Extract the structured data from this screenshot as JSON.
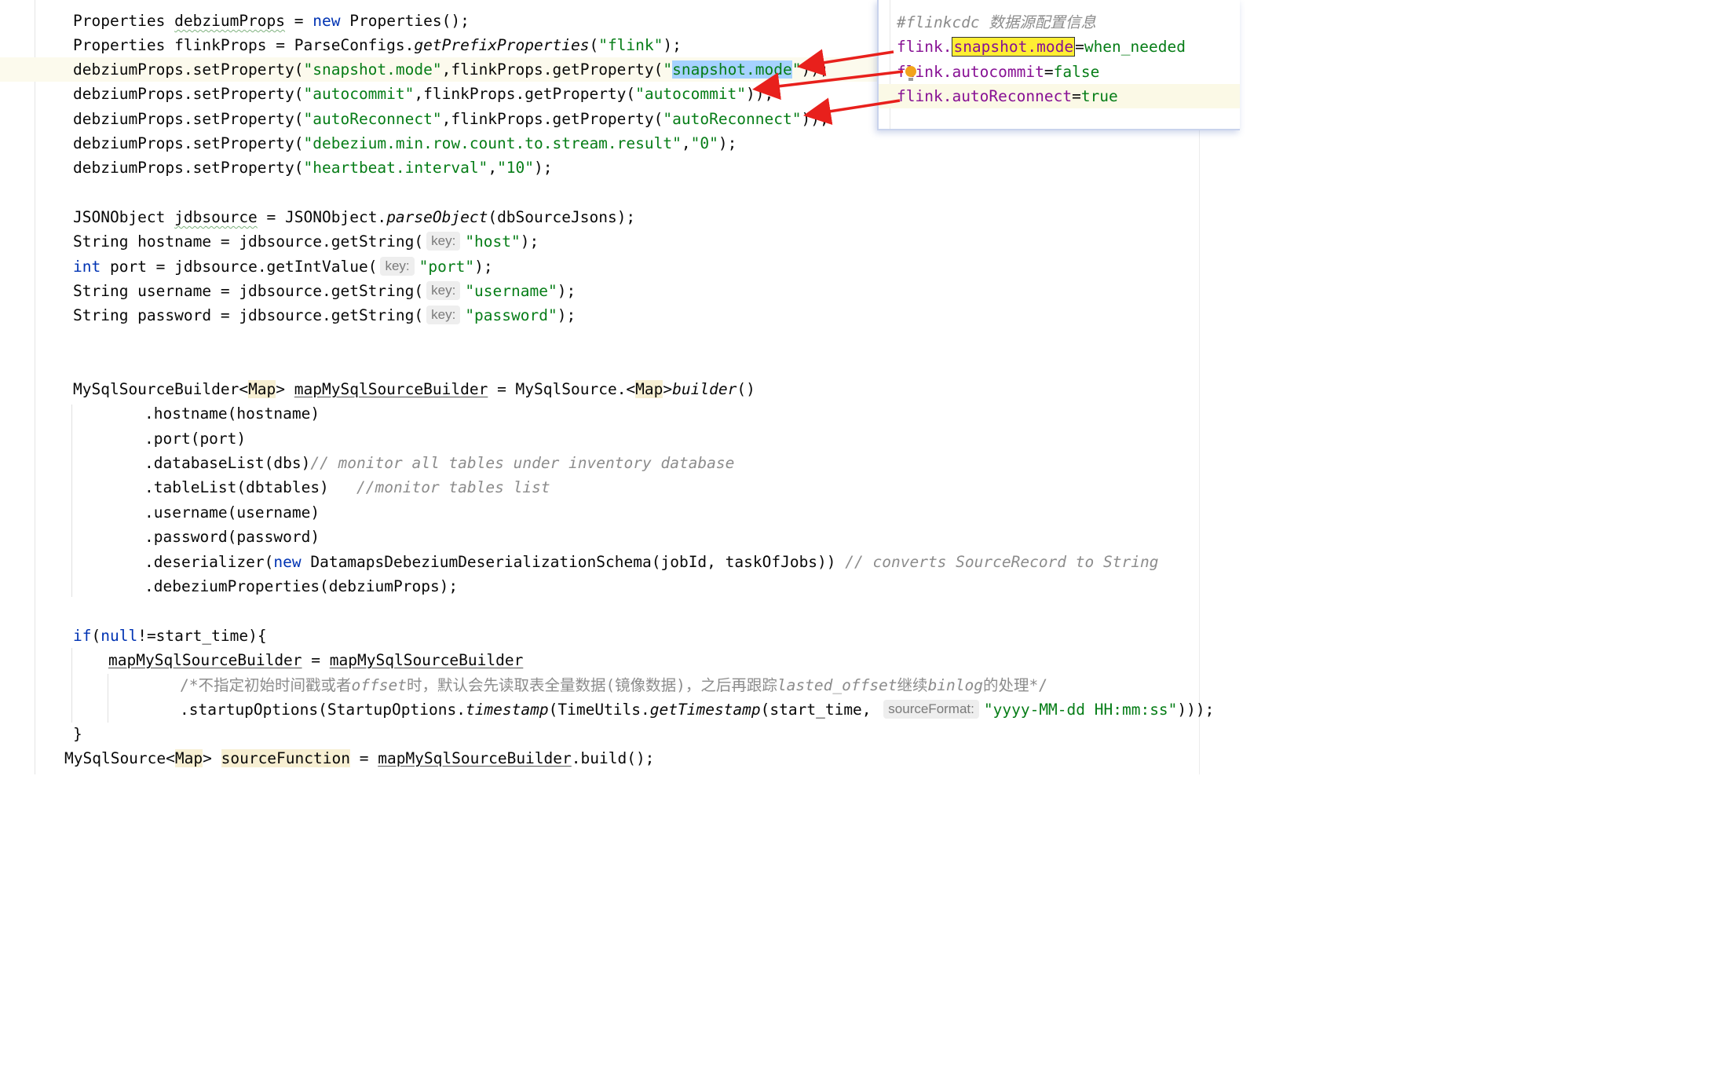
{
  "code": {
    "l1": {
      "a": "Properties ",
      "b": "debziumProps",
      "c": " = ",
      "d": "new",
      "e": " Properties();"
    },
    "l2": {
      "a": "Properties flinkProps = ParseConfigs.",
      "b": "getPrefixProperties",
      "c": "(",
      "d": "\"flink\"",
      "e": ");"
    },
    "l3": {
      "a": "debziumProps.setProperty(",
      "b": "\"snapshot.mode\"",
      "c": ",flinkProps.getProperty(",
      "d": "\"",
      "e": "snapshot.mode",
      "f": "\"",
      "g": "));"
    },
    "l4": {
      "a": "debziumProps.setProperty(",
      "b": "\"autocommit\"",
      "c": ",flinkProps.getProperty(",
      "d": "\"autocommit\"",
      "e": "));"
    },
    "l5": {
      "a": "debziumProps.setProperty(",
      "b": "\"autoReconnect\"",
      "c": ",flinkProps.getProperty(",
      "d": "\"autoReconnect\"",
      "e": "));"
    },
    "l6": {
      "a": "debziumProps.setProperty(",
      "b": "\"debezium.min.row.count.to.stream.result\"",
      "c": ",",
      "d": "\"0\"",
      "e": ");"
    },
    "l7": {
      "a": "debziumProps.setProperty(",
      "b": "\"heartbeat.interval\"",
      "c": ",",
      "d": "\"10\"",
      "e": ");"
    },
    "l8": {
      "a": "JSONObject ",
      "b": "jdbsource",
      "c": " = JSONObject.",
      "d": "parseObject",
      "e": "(dbSourceJsons);"
    },
    "l9": {
      "a": "String hostname = jdbsource.getString(",
      "hint": "key:",
      "b": "\"host\"",
      "c": ");"
    },
    "l10": {
      "a": "int",
      "b": " port = jdbsource.getIntValue(",
      "hint": "key:",
      "c": "\"port\"",
      "d": ");"
    },
    "l11": {
      "a": "String username = jdbsource.getString(",
      "hint": "key:",
      "b": "\"username\"",
      "c": ");"
    },
    "l12": {
      "a": "String password = jdbsource.getString(",
      "hint": "key:",
      "b": "\"password\"",
      "c": ");"
    },
    "l13": {
      "a": "MySqlSourceBuilder<",
      "b": "Map",
      "c": "> ",
      "d": "mapMySqlSourceBuilder",
      "e": " = MySqlSource.<",
      "f": "Map",
      "g": ">",
      "h": "builder",
      "i": "()"
    },
    "l14": {
      "a": ".hostname(hostname)"
    },
    "l15": {
      "a": ".port(port)"
    },
    "l16": {
      "a": ".databaseList(dbs)",
      "b": "// monitor all tables under inventory database"
    },
    "l17": {
      "a": ".tableList(dbtables)   ",
      "b": "//monitor tables list"
    },
    "l18": {
      "a": ".username(username)"
    },
    "l19": {
      "a": ".password(password)"
    },
    "l20": {
      "a": ".deserializer(",
      "b": "new",
      "c": " DatamapsDebeziumDeserializationSchema(jobId, taskOfJobs)) ",
      "d": "// converts SourceRecord to String"
    },
    "l21": {
      "a": ".debeziumProperties(debziumProps);"
    },
    "l22": {
      "a": "if",
      "b": "(",
      "c": "null",
      "d": "!=start_time){"
    },
    "l23": {
      "a": "mapMySqlSourceBuilder",
      "b": " = ",
      "c": "mapMySqlSourceBuilder"
    },
    "l24": {
      "a": "/*不指定初始时间戳或者",
      "b": "offset",
      "c": "时，默认会先读取表全量数据(镜像数据)，之后再跟踪",
      "d": "lasted_offset",
      "e": "继续",
      "f": "binlog",
      "g": "的处理*/"
    },
    "l25": {
      "a": ".startupOptions(StartupOptions.",
      "b": "timestamp",
      "c": "(TimeUtils.",
      "d": "getTimestamp",
      "e": "(start_time, ",
      "hint": "sourceFormat:",
      "f": "\"yyyy-MM-dd HH:mm:ss\"",
      "g": ")));"
    },
    "l26": {
      "a": "}"
    },
    "l27": {
      "a": "MySqlSource<",
      "b": "Map",
      "c": "> ",
      "d": "sourceFunction",
      "e": " = ",
      "f": "mapMySqlSourceBuilder",
      "g": ".build();"
    }
  },
  "popup": {
    "comment": "#flinkcdc 数据源配置信息",
    "prop1": {
      "prefix": "flink.",
      "key": "snapshot.mode",
      "eq": "=",
      "value": "when_needed"
    },
    "prop2": {
      "prefix": "flink.",
      "key": "autocommit",
      "eq": "=",
      "value": "false"
    },
    "prop3": {
      "prefix": "flink.",
      "key": "autoReconnect",
      "eq": "=",
      "value": "true"
    }
  },
  "colors": {
    "keyword": "#0033b3",
    "string": "#067d17",
    "comment": "#8c8c8c",
    "property_key": "#871094",
    "arrow": "#e8201c"
  }
}
